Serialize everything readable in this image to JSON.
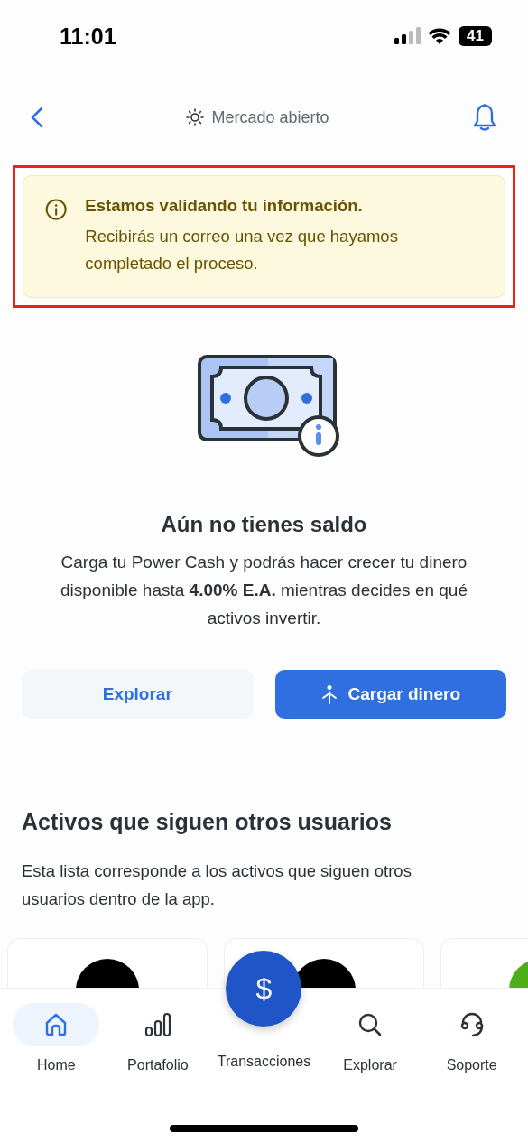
{
  "status_bar": {
    "time": "11:01",
    "battery": "41"
  },
  "header": {
    "market_status": "Mercado abierto"
  },
  "banner": {
    "highlighted": true,
    "title": "Estamos validando tu información.",
    "message": "Recibirás un correo una vez que hayamos completado el proceso."
  },
  "empty_state": {
    "title": "Aún no tienes saldo",
    "text": "Carga tu Power Cash y podrás hacer crecer tu dinero disponible hasta **4.00% E.A.** mientras decides en qué activos invertir.",
    "buttons": [
      {
        "label": "Explorar",
        "kind": "secondary"
      },
      {
        "label": "Cargar dinero",
        "kind": "primary"
      }
    ]
  },
  "followed_assets": {
    "title": "Activos que siguen otros usuarios",
    "text": "Esta lista corresponde a los activos que siguen otros usuarios dentro de la app.",
    "cards": [
      {
        "color": "#000000"
      },
      {
        "color": "#000000"
      },
      {
        "color": "#4caf1a"
      }
    ]
  },
  "fab": {
    "label": "$"
  },
  "nav": [
    {
      "label": "Home",
      "kind": "home",
      "selected": true
    },
    {
      "label": "Portafolio",
      "kind": "portfolio",
      "selected": false
    },
    {
      "label": "Transacciones",
      "kind": "transactions",
      "selected": false
    },
    {
      "label": "Explorar",
      "kind": "explore",
      "selected": false
    },
    {
      "label": "Soporte",
      "kind": "support",
      "selected": false
    }
  ]
}
